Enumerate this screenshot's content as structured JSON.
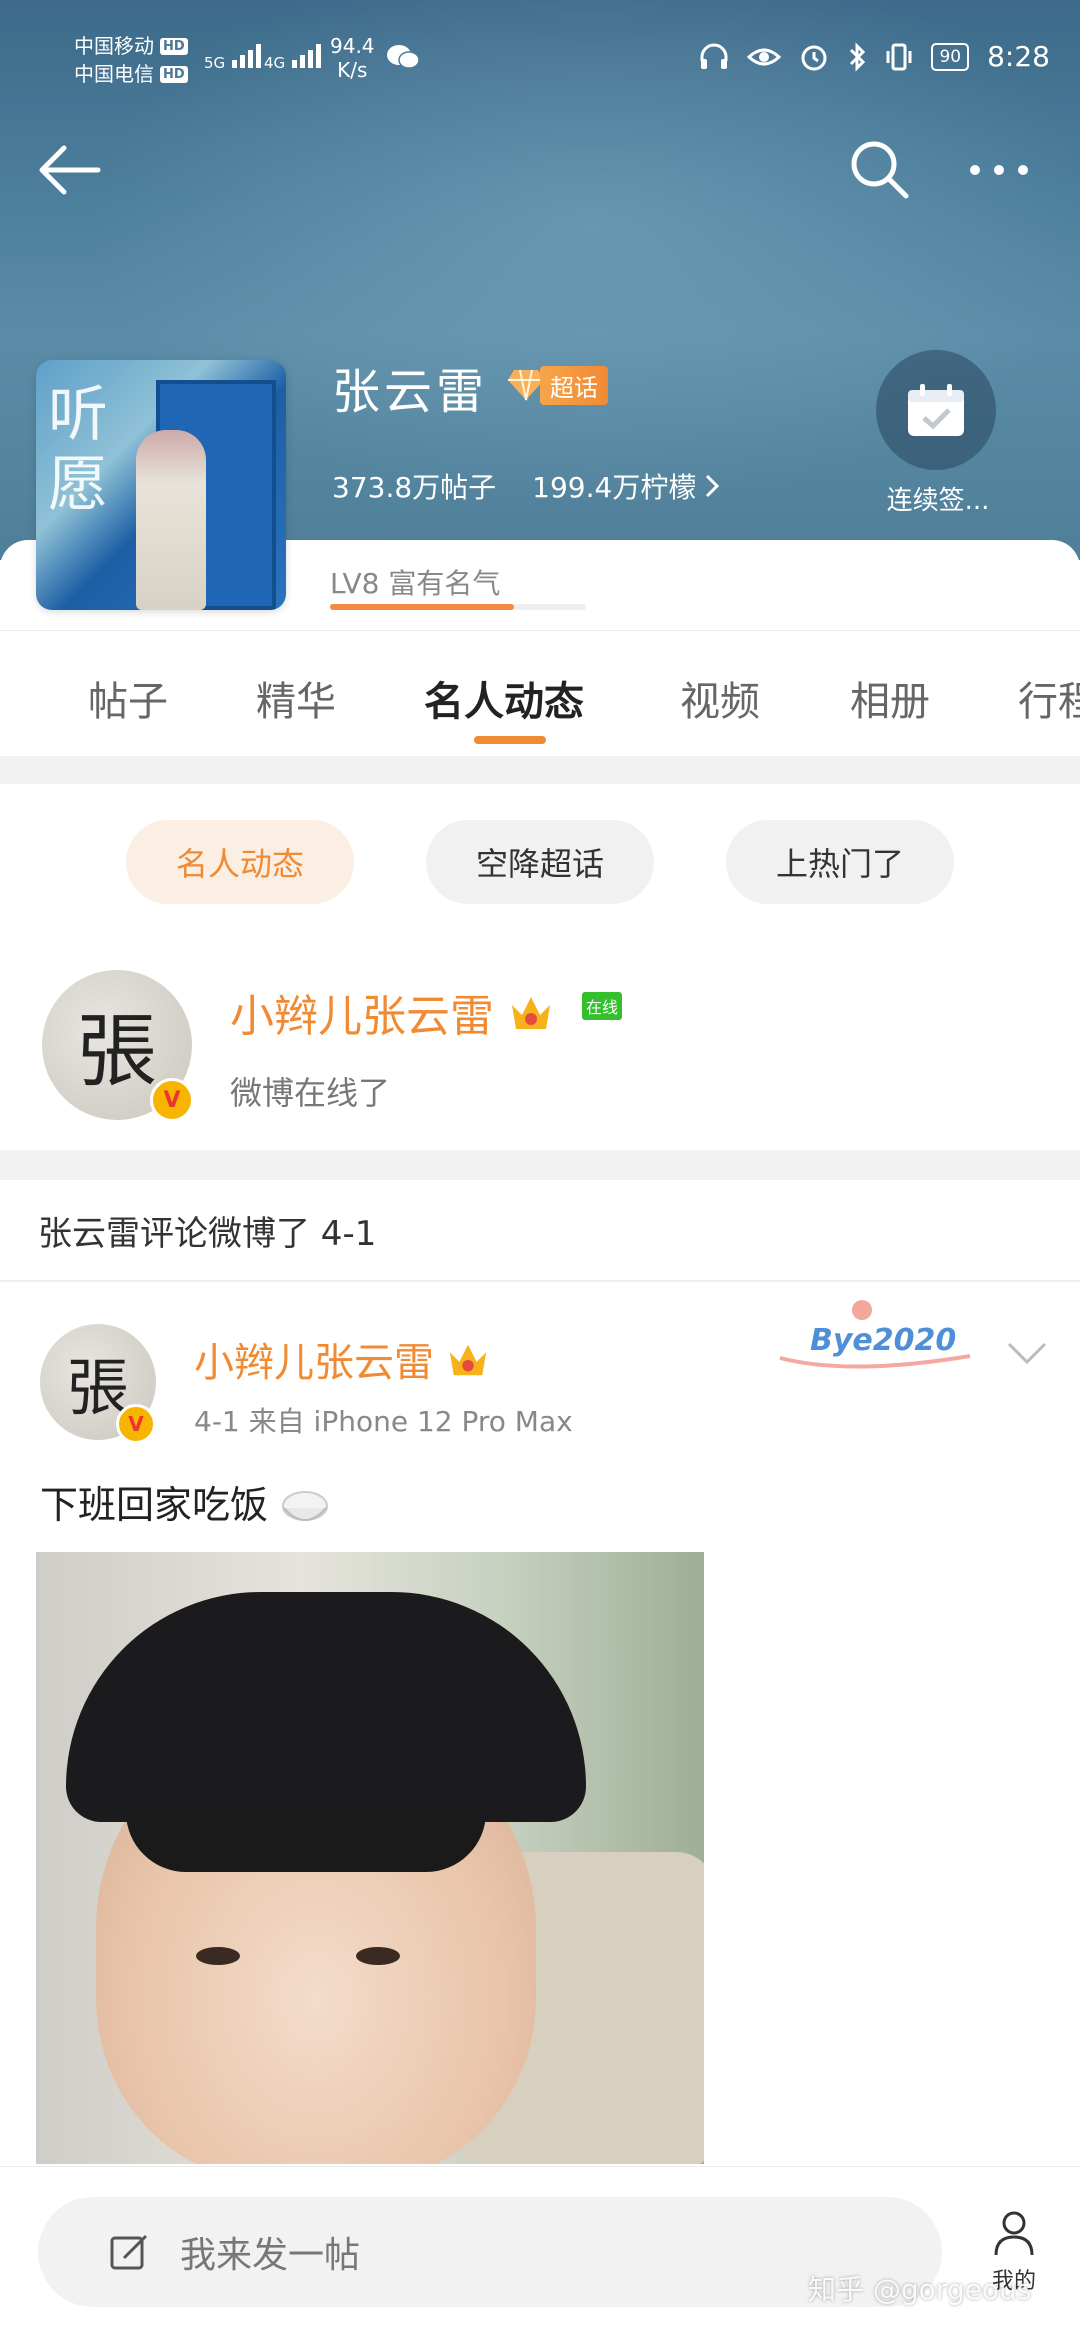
{
  "status_bar": {
    "carrier1": "中国移动",
    "carrier2": "中国电信",
    "hd": "HD",
    "net1": "5G",
    "net2": "4G",
    "speed_value": "94.4",
    "speed_unit": "K/s",
    "battery": "90",
    "time": "8:28"
  },
  "topic": {
    "title": "张云雷",
    "badge": "超话",
    "posts": "373.8万帖子",
    "followers": "199.4万柠檬",
    "checkin": "连续签...",
    "level": "LV8 富有名气",
    "level_progress": 0.72
  },
  "tabs": [
    "帖子",
    "精华",
    "名人动态",
    "视频",
    "相册",
    "行程"
  ],
  "active_tab": "名人动态",
  "chips": [
    "名人动态",
    "空降超话",
    "上热门了"
  ],
  "online_card": {
    "name": "小辫儿张云雷",
    "badge": "在线",
    "status": "微博在线了"
  },
  "comment_header": "张云雷评论微博了 4-1",
  "post": {
    "author": "小辫儿张云雷",
    "meta": "4-1  来自 iPhone 12 Pro Max",
    "text": "下班回家吃饭",
    "sticker": "Bye2020"
  },
  "compose": {
    "placeholder": "我来发一帖",
    "me": "我的"
  },
  "watermark": "知乎 @gorgeous",
  "colors": {
    "accent": "#f08a33",
    "header": "#4c7f9c",
    "online": "#34c02c"
  }
}
